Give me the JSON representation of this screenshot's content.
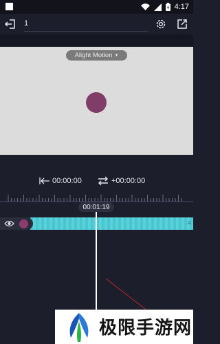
{
  "status_bar": {
    "time": "4:17",
    "icons": [
      "wifi-icon",
      "signal-icon",
      "battery-icon"
    ]
  },
  "toolbar": {
    "exit_icon": "exit-icon",
    "project_name": "1",
    "settings_icon": "gear-icon",
    "export_icon": "export-icon"
  },
  "preview": {
    "watermark_label": "Alight Motion",
    "background_color": "#dcdcdc",
    "shape_color": "#7f3d68"
  },
  "playback": {
    "start_time": "00:00:00",
    "offset_time": "+00:00:00",
    "current_time": "00:01:19"
  },
  "timeline": {
    "layer_color": "#4fc9d1",
    "layer_thumb_color": "#8e3c6e"
  },
  "banner": {
    "logo_text": "极限手游网"
  }
}
